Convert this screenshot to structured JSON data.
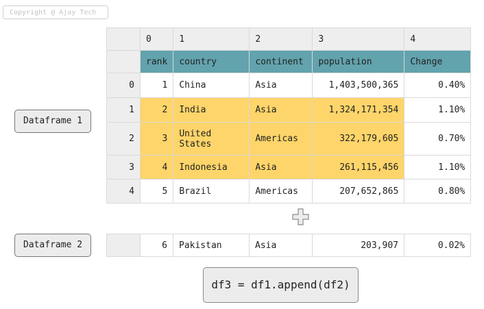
{
  "copyright": "Copyright @ Ajay Tech",
  "labels": {
    "df1": "Dataframe 1",
    "df2": "Dataframe 2"
  },
  "df1": {
    "column_indices": [
      "0",
      "1",
      "2",
      "3",
      "4"
    ],
    "column_names": [
      "rank",
      "country",
      "continent",
      "population",
      "Change"
    ],
    "rows": [
      {
        "index": "0",
        "rank": "1",
        "country": "China",
        "continent": "Asia",
        "population": "1,403,500,365",
        "change": "0.40%"
      },
      {
        "index": "1",
        "rank": "2",
        "country": "India",
        "continent": "Asia",
        "population": "1,324,171,354",
        "change": "1.10%"
      },
      {
        "index": "2",
        "rank": "3",
        "country": "United States",
        "continent": "Americas",
        "population": "322,179,605",
        "change": "0.70%"
      },
      {
        "index": "3",
        "rank": "4",
        "country": "Indonesia",
        "continent": "Asia",
        "population": "261,115,456",
        "change": "1.10%"
      },
      {
        "index": "4",
        "rank": "5",
        "country": "Brazil",
        "continent": "Americas",
        "population": "207,652,865",
        "change": "0.80%"
      }
    ]
  },
  "df2": {
    "rows": [
      {
        "index": "",
        "rank": "6",
        "country": "Pakistan",
        "continent": "Asia",
        "population": "203,907",
        "change": "0.02%"
      }
    ]
  },
  "plus_icon": "plus-icon",
  "code": "df3 = df1.append(df2)",
  "colors": {
    "header": "#62a3ad",
    "highlight": "#fed56a",
    "index_bg": "#eeeeee"
  }
}
